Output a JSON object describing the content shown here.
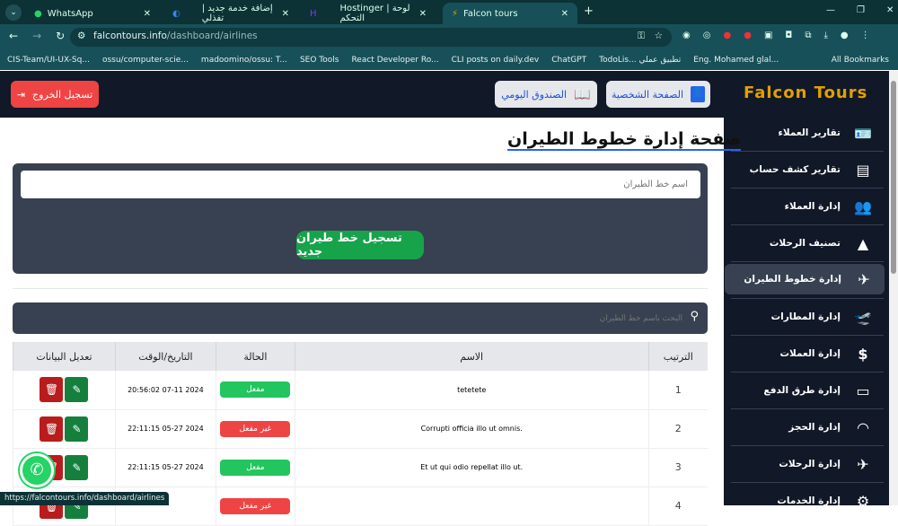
{
  "browser": {
    "tabs": [
      {
        "title": "WhatsApp"
      },
      {
        "title": "إضافة خدمة جديد | تفذلي"
      },
      {
        "title": "Hostinger | لوحة التحكم"
      },
      {
        "title": "Falcon tours",
        "active": true
      }
    ],
    "url_host": "falcontours.info",
    "url_path": "/dashboard/airlines",
    "bookmarks": [
      "CIS-Team/UI-UX-Sq...",
      "ossu/computer-scie...",
      "madoomino/ossu: T...",
      "SEO Tools",
      "React Developer Ro...",
      "CLI posts on daily.dev",
      "ChatGPT",
      "TodoLis... تطبيق عملي",
      "Eng. Mohamed glal..."
    ],
    "all_bookmarks": "All Bookmarks",
    "status_url": "https://falcontours.info/dashboard/airlines"
  },
  "header": {
    "logout": "تسجيل الخروج",
    "daily_box": "الصندوق اليومي",
    "profile": "الصفحة الشخصية"
  },
  "logo": "Falcon Tours",
  "sidebar": [
    {
      "label": "تقارير العملاء",
      "icon": "id-card-icon",
      "glyph": "🪪"
    },
    {
      "label": "تقارير كشف حساب",
      "icon": "report-icon",
      "glyph": "▤"
    },
    {
      "label": "إدارة العملاء",
      "icon": "users-icon",
      "glyph": "👥"
    },
    {
      "label": "تصنيف الرحلات",
      "icon": "shapes-icon",
      "glyph": "▲"
    },
    {
      "label": "إدارة خطوط الطيران",
      "icon": "airlines-icon",
      "glyph": "✈"
    },
    {
      "label": "إدارة المطارات",
      "icon": "plane-departure-icon",
      "glyph": "🛫"
    },
    {
      "label": "إدارة العملات",
      "icon": "dollar-icon",
      "glyph": "$"
    },
    {
      "label": "إدارة طرق الدفع",
      "icon": "credit-card-icon",
      "glyph": "▭"
    },
    {
      "label": "إدارة الحجز",
      "icon": "booking-icon",
      "glyph": "◠"
    },
    {
      "label": "إدارة الرحلات",
      "icon": "plane-icon",
      "glyph": "✈"
    },
    {
      "label": "إدارة الخدمات",
      "icon": "gear-icon",
      "glyph": "⚙"
    }
  ],
  "page": {
    "title": "صفحة إدارة خطوط الطيران",
    "name_placeholder": "اسم خط الطيران",
    "submit": "تسجيل خط طيران جديد",
    "search_placeholder": "البحث باسم خط الطيران"
  },
  "table": {
    "headers": [
      "الترتيب",
      "الاسم",
      "الحالة",
      "التاريخ/الوقت",
      "تعديل البيانات"
    ],
    "rows": [
      {
        "n": "1",
        "name": "tetetete",
        "status": "مفعل",
        "active": true,
        "date": "20:56:02 07-11 2024"
      },
      {
        "n": "2",
        "name": "Corrupti officia illo ut omnis.",
        "status": "غير مفعل",
        "active": false,
        "date": "22:11:15 05-27 2024"
      },
      {
        "n": "3",
        "name": "Et ut qui odio repellat illo ut.",
        "status": "مفعل",
        "active": true,
        "date": "22:11:15 05-27 2024"
      },
      {
        "n": "4",
        "name": "",
        "status": "غير مفعل",
        "active": false,
        "date": ""
      }
    ]
  },
  "colors": {
    "active": "#22c55e",
    "inactive": "#ef4444",
    "sidebar": "#111827",
    "panel": "#374151",
    "accent": "#e0a100"
  }
}
